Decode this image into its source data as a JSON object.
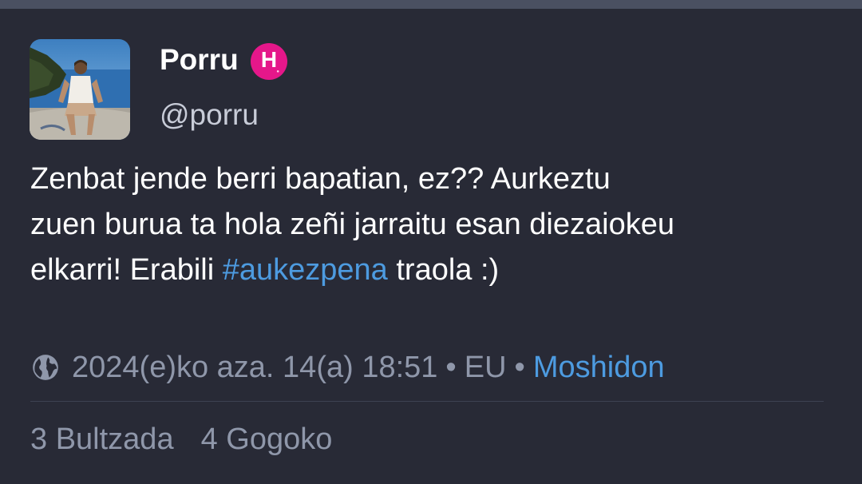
{
  "post": {
    "author": {
      "display_name": "Porru",
      "handle": "@porru",
      "instance_badge": {
        "letter": "H",
        "icon": "instance-logo-icon",
        "color": "#e5178a"
      },
      "avatar": "avatar-photo"
    },
    "text_lines": [
      "Zenbat jende berri bapatian, ez?? Aurkeztu",
      "zuen burua ta hola zeñi jarraitu esan diezaiokeu"
    ],
    "last_line": {
      "before": "elkarri! Erabili ",
      "hashtag": "#aukezpena",
      "after": " traola :)"
    },
    "meta": {
      "visibility_icon": "globe-icon",
      "timestamp": "2024(e)ko aza. 14(a) 18:51",
      "separator": "•",
      "language": "EU",
      "app": "Moshidon"
    },
    "stats": {
      "boosts": "3 Bultzada",
      "favourites": "4 Gogoko"
    }
  },
  "colors": {
    "background": "#282a36",
    "link": "#4d9be0",
    "muted": "#8f97aa",
    "handle": "#c8ccd8"
  }
}
